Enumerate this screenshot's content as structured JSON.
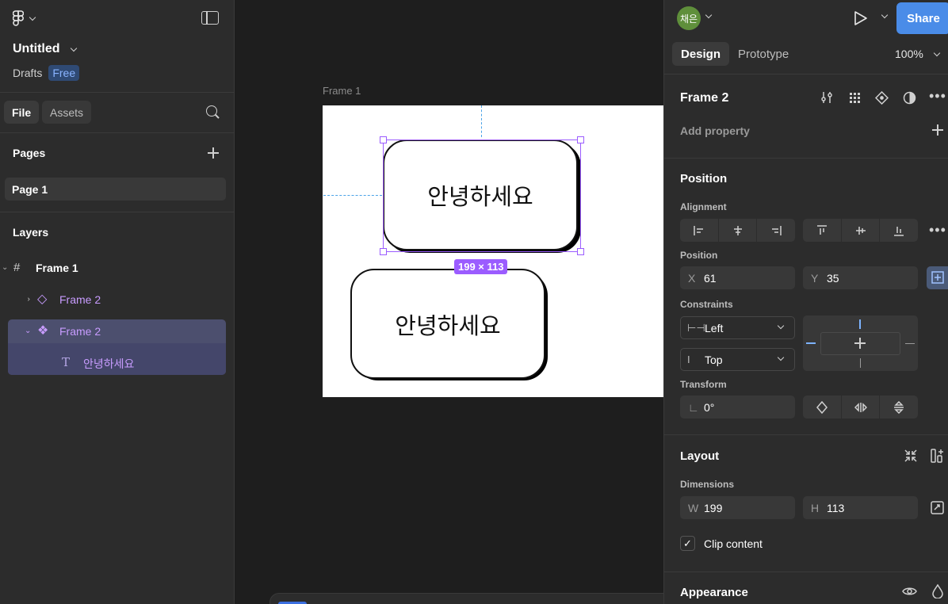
{
  "left_panel": {
    "file_title": "Untitled",
    "project": "Drafts",
    "plan_badge": "Free",
    "tabs": {
      "file": "File",
      "assets": "Assets"
    },
    "pages_heading": "Pages",
    "pages": [
      "Page 1"
    ],
    "layers_heading": "Layers",
    "layers": [
      {
        "label": "Frame 1",
        "icon": "frame-hash-icon"
      },
      {
        "label": "Frame 2",
        "icon": "component-instance-icon"
      },
      {
        "label": "Frame 2",
        "icon": "component-main-icon"
      },
      {
        "label": "안녕하세요",
        "icon": "text-layer-icon"
      }
    ]
  },
  "canvas": {
    "frame_label": "Frame 1",
    "card_top_text": "안녕하세요",
    "card_bottom_text": "안녕하세요",
    "dimension_badge": "199 × 113",
    "selection_color": "#9b5cff",
    "guide_color": "#4aa3e8"
  },
  "right_panel": {
    "avatar_text": "채은",
    "share_label": "Share",
    "tabs": {
      "design": "Design",
      "prototype": "Prototype"
    },
    "zoom": "100%",
    "selection_name": "Frame 2",
    "add_property": "Add property",
    "position_heading": "Position",
    "alignment_label": "Alignment",
    "position_label": "Position",
    "x_label": "X",
    "x_value": "61",
    "y_label": "Y",
    "y_value": "35",
    "constraints_label": "Constraints",
    "constraint_h": "Left",
    "constraint_v": "Top",
    "transform_label": "Transform",
    "rotation": "0°",
    "layout_heading": "Layout",
    "dimensions_label": "Dimensions",
    "w_label": "W",
    "w_value": "199",
    "h_label": "H",
    "h_value": "113",
    "clip_content": "Clip content",
    "appearance_heading": "Appearance",
    "accent_color": "#4a8ce8"
  }
}
